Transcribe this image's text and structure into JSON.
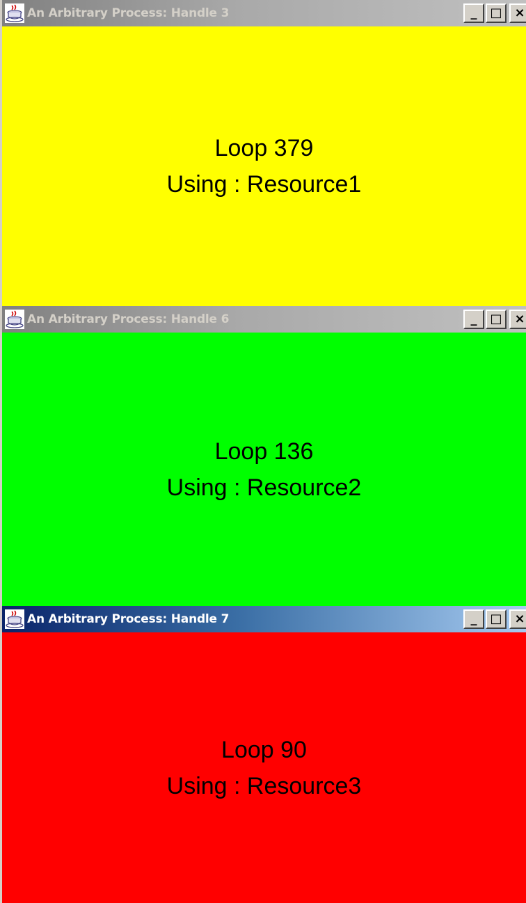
{
  "windows": [
    {
      "title": "An Arbitrary Process: Handle 3",
      "title_state": "inactive",
      "body_color": "#ffff00",
      "loop_text": "Loop 379",
      "resource_text": "Using : Resource1",
      "controls": {
        "minimize": "_",
        "maximize": "□",
        "close": "×"
      }
    },
    {
      "title": "An Arbitrary Process: Handle 6",
      "title_state": "inactive",
      "body_color": "#00ff00",
      "loop_text": "Loop 136",
      "resource_text": "Using : Resource2",
      "controls": {
        "minimize": "_",
        "maximize": "□",
        "close": "×"
      }
    },
    {
      "title": "An Arbitrary Process: Handle 7",
      "title_state": "active",
      "body_color": "#ff0000",
      "loop_text": "Loop 90",
      "resource_text": "Using : Resource3",
      "controls": {
        "minimize": "_",
        "maximize": "□",
        "close": "×"
      }
    }
  ],
  "icons": {
    "app": "java-cup-icon"
  }
}
